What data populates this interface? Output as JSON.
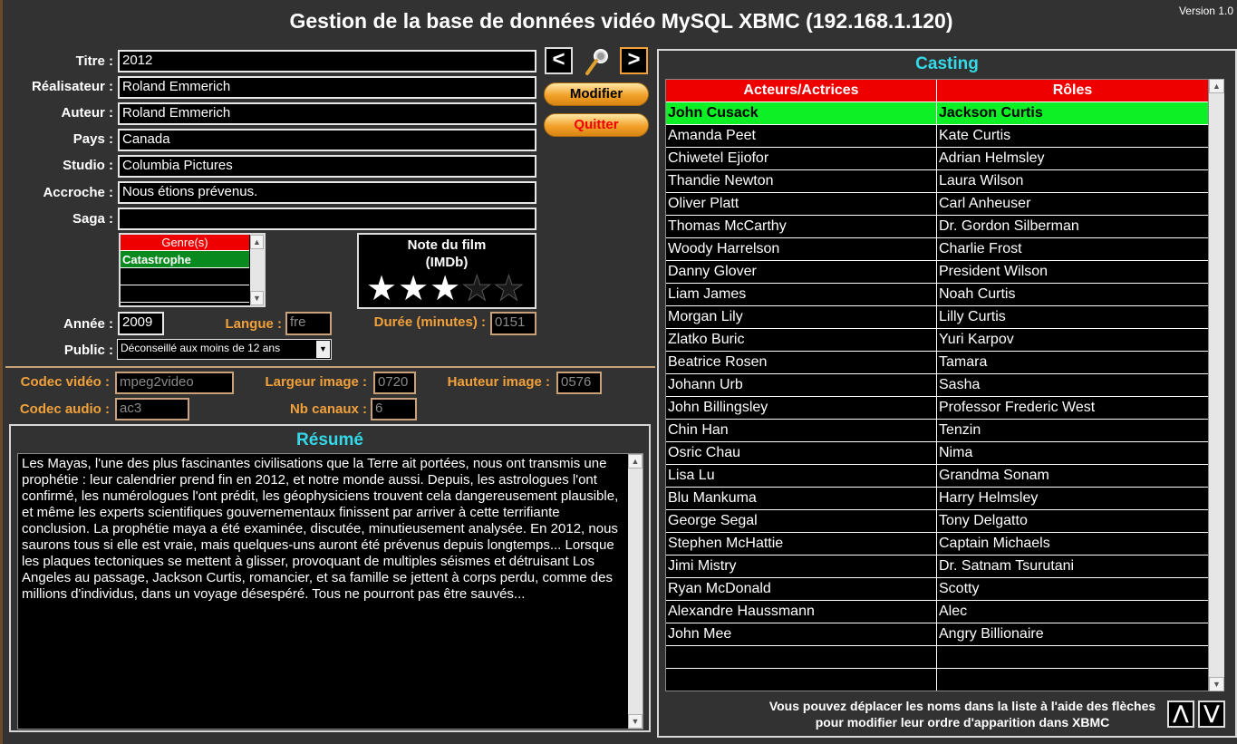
{
  "window": {
    "title": "Gestion de la base de données vidéo MySQL XBMC (192.168.1.120)",
    "version": "Version 1.0"
  },
  "form": {
    "titre": {
      "label": "Titre :",
      "value": "2012"
    },
    "realisateur": {
      "label": "Réalisateur :",
      "value": "Roland Emmerich"
    },
    "auteur": {
      "label": "Auteur :",
      "value": "Roland Emmerich"
    },
    "pays": {
      "label": "Pays :",
      "value": "Canada"
    },
    "studio": {
      "label": "Studio :",
      "value": "Columbia Pictures"
    },
    "accroche": {
      "label": "Accroche :",
      "value": "Nous étions prévenus."
    },
    "saga": {
      "label": "Saga :",
      "value": ""
    },
    "annee": {
      "label": "Année :",
      "value": "2009"
    },
    "langue": {
      "label": "Langue :",
      "value": "fre"
    },
    "duree": {
      "label": "Durée (minutes) :",
      "value": "0151"
    },
    "public": {
      "label": "Public :",
      "value": "Déconseillé aux moins de 12 ans"
    }
  },
  "genres": {
    "header": "Genre(s)",
    "items": [
      "Catastrophe"
    ]
  },
  "rating": {
    "title_line1": "Note du film",
    "title_line2": "(IMDb)",
    "stars": 3,
    "max": 5
  },
  "buttons": {
    "prev": "<",
    "next": ">",
    "modifier": "Modifier",
    "quitter": "Quitter"
  },
  "tech": {
    "codec_video": {
      "label": "Codec vidéo :",
      "value": "mpeg2video"
    },
    "largeur": {
      "label": "Largeur image :",
      "value": "0720"
    },
    "hauteur": {
      "label": "Hauteur image :",
      "value": "0576"
    },
    "codec_audio": {
      "label": "Codec audio :",
      "value": "ac3"
    },
    "canaux": {
      "label": "Nb canaux :",
      "value": "6"
    }
  },
  "resume": {
    "title": "Résumé",
    "text": "Les Mayas, l'une des plus fascinantes civilisations que la Terre ait portées, nous ont transmis une prophétie : leur calendrier prend fin en 2012, et notre monde aussi. Depuis, les astrologues l'ont confirmé, les numérologues l'ont prédit, les géophysiciens trouvent cela dangereusement plausible, et même les experts scientifiques gouvernementaux finissent par arriver à cette terrifiante conclusion. La prophétie maya a été examinée, discutée, minutieusement analysée. En 2012, nous saurons tous si elle est vraie, mais quelques-uns auront été prévenus depuis longtemps... Lorsque les plaques tectoniques se mettent à glisser, provoquant de multiples séismes et détruisant Los Angeles au passage, Jackson Curtis, romancier, et sa famille se jettent à corps perdu, comme des millions d'individus, dans un voyage désespéré. Tous ne pourront pas être sauvés..."
  },
  "casting": {
    "title": "Casting",
    "columns": [
      "Acteurs/Actrices",
      "Rôles"
    ],
    "rows": [
      [
        "John Cusack",
        "Jackson Curtis"
      ],
      [
        "Amanda Peet",
        "Kate Curtis"
      ],
      [
        "Chiwetel Ejiofor",
        "Adrian Helmsley"
      ],
      [
        "Thandie Newton",
        "Laura Wilson"
      ],
      [
        "Oliver Platt",
        "Carl Anheuser"
      ],
      [
        "Thomas McCarthy",
        "Dr. Gordon Silberman"
      ],
      [
        "Woody Harrelson",
        "Charlie Frost"
      ],
      [
        "Danny Glover",
        "President Wilson"
      ],
      [
        "Liam James",
        "Noah Curtis"
      ],
      [
        "Morgan Lily",
        "Lilly Curtis"
      ],
      [
        "Zlatko Buric",
        "Yuri Karpov"
      ],
      [
        "Beatrice Rosen",
        "Tamara"
      ],
      [
        "Johann Urb",
        "Sasha"
      ],
      [
        "John Billingsley",
        "Professor Frederic West"
      ],
      [
        "Chin Han",
        "Tenzin"
      ],
      [
        "Osric Chau",
        "Nima"
      ],
      [
        "Lisa Lu",
        "Grandma Sonam"
      ],
      [
        "Blu Mankuma",
        "Harry Helmsley"
      ],
      [
        "George Segal",
        "Tony Delgatto"
      ],
      [
        "Stephen McHattie",
        "Captain Michaels"
      ],
      [
        "Jimi Mistry",
        "Dr. Satnam Tsurutani"
      ],
      [
        "Ryan McDonald",
        "Scotty"
      ],
      [
        "Alexandre Haussmann",
        "Alec"
      ],
      [
        "John Mee",
        "Angry Billionaire"
      ],
      [
        "",
        ""
      ],
      [
        "",
        ""
      ]
    ],
    "footer_line1": "Vous pouvez déplacer les noms dans la liste à l'aide des flèches",
    "footer_line2": "pour modifier leur ordre d'apparition dans XBMC"
  }
}
